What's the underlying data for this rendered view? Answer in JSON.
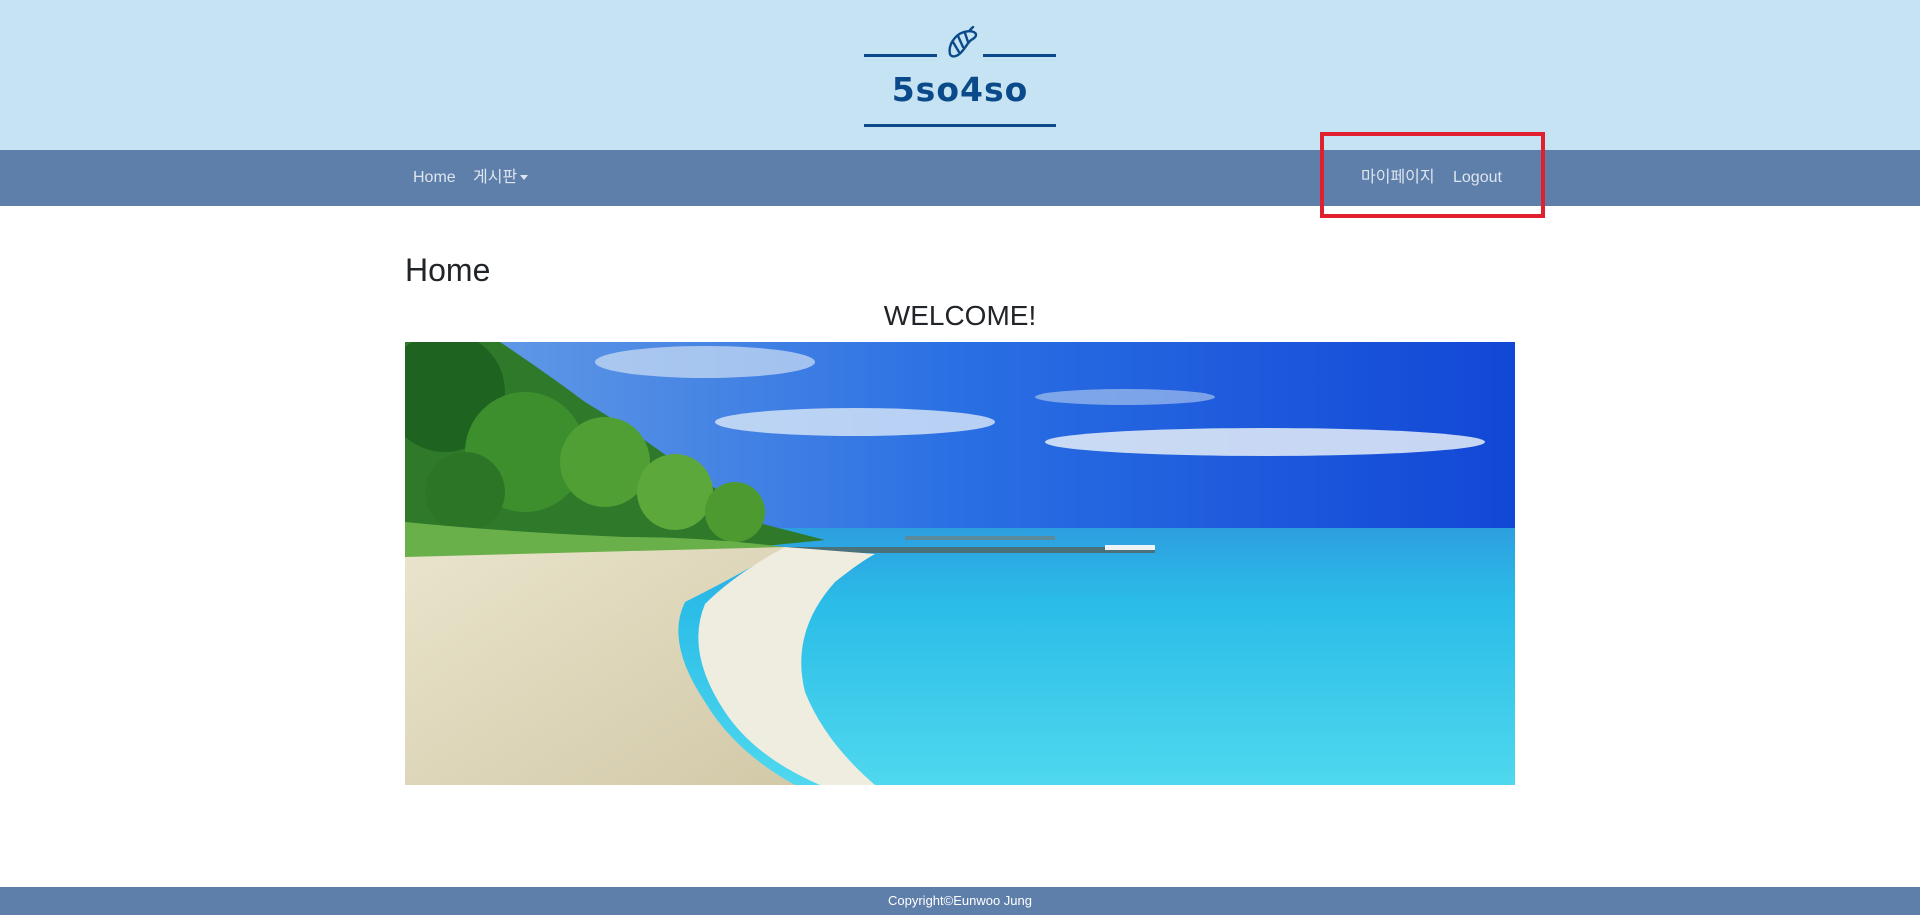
{
  "brand": {
    "name": "5so4so",
    "icon": "croissant-icon",
    "color": "#0b4a8a",
    "header_bg": "#c5e3f2"
  },
  "navbar": {
    "bg": "#5f7fab",
    "left": [
      {
        "label": "Home"
      },
      {
        "label": "게시판",
        "dropdown": true
      }
    ],
    "right": [
      {
        "label": "마이페이지"
      },
      {
        "label": "Logout"
      }
    ],
    "highlight_color": "#e0202e"
  },
  "main": {
    "title": "Home",
    "welcome": "WELCOME!",
    "hero_image": "tropical-beach-image"
  },
  "footer": {
    "text": "Copyright©Eunwoo Jung"
  }
}
